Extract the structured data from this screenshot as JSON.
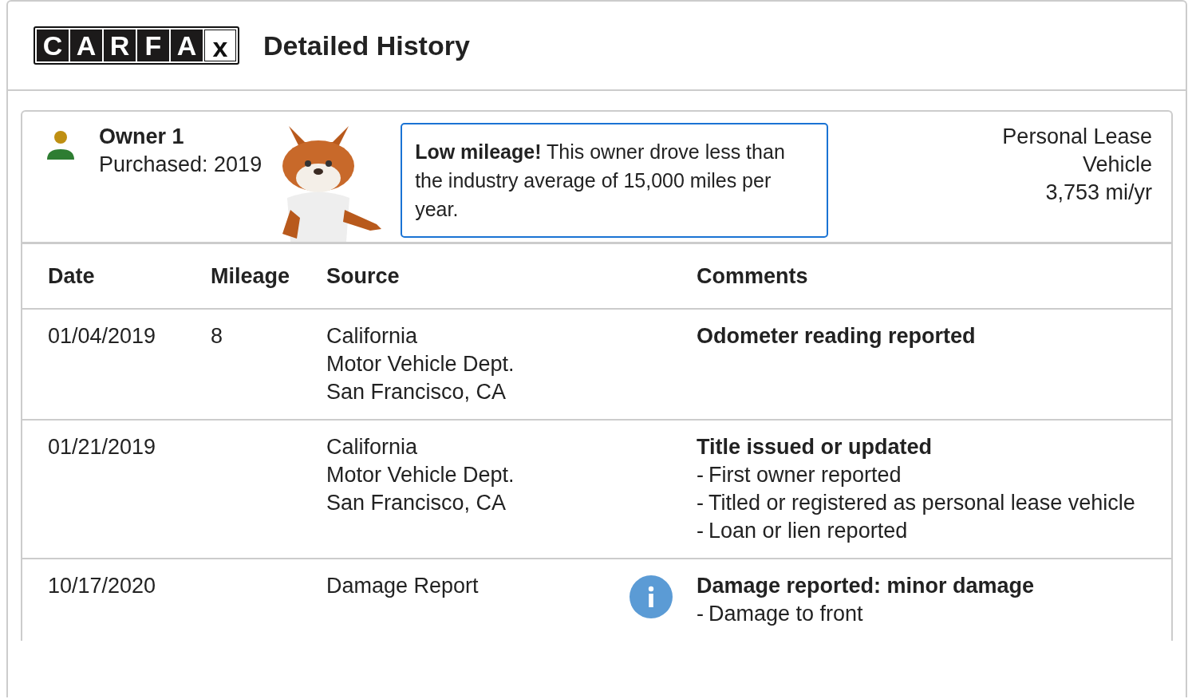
{
  "header": {
    "logo_letters": [
      "C",
      "A",
      "R",
      "F",
      "A",
      "x"
    ],
    "title": "Detailed History"
  },
  "owner": {
    "name": "Owner 1",
    "purchased": "Purchased: 2019",
    "callout": "**Low mileage!** This owner drove less than the industry average of 15,000 miles per year.",
    "usage_lines": [
      "Personal Lease",
      "Vehicle",
      "3,753 mi/yr"
    ]
  },
  "table": {
    "columns": [
      "Date",
      "Mileage",
      "Source",
      "Comments"
    ],
    "rows": [
      {
        "date": "01/04/2019",
        "mileage": "8",
        "source": [
          "California",
          "Motor Vehicle Dept.",
          "San Francisco, CA"
        ],
        "kind": "plain",
        "comment_title": "Odometer reading reported",
        "details": []
      },
      {
        "date": "01/21/2019",
        "mileage": "",
        "source": [
          "California",
          "Motor Vehicle Dept.",
          "San Francisco, CA"
        ],
        "kind": "plain",
        "comment_title": "Title issued or updated",
        "details": [
          {
            "marker": "-",
            "text": "First owner reported"
          },
          {
            "marker": "-",
            "text": "Titled or registered as personal lease vehicle"
          },
          {
            "marker": "-",
            "text": "Loan or lien reported"
          }
        ]
      },
      {
        "date": "10/17/2020",
        "mileage": "",
        "source": [
          "Damage Report"
        ],
        "kind": "info",
        "comment_title": "Damage reported: minor damage",
        "details": [
          {
            "marker": "-",
            "text": "Damage to front"
          }
        ]
      }
    ]
  }
}
